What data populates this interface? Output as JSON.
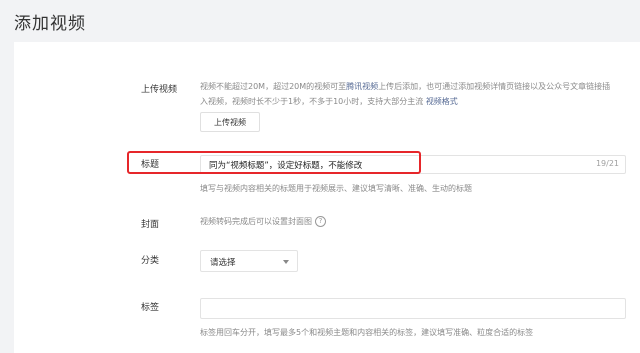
{
  "page": {
    "title": "添加视频"
  },
  "upload": {
    "label": "上传视频",
    "desc_part1": "视频不能超过20M，超过20M的视频可至",
    "desc_link1": "腾讯视频",
    "desc_part2": "上传后添加，也可通过添加视频详情页链接以及公众号文章链接插",
    "desc_line2_prefix": "入视频，视频时长不少于1秒，不多于10小时，支持大部分主流 ",
    "desc_link2": "视频格式",
    "button_label": "上传视频"
  },
  "title_field": {
    "label": "标题",
    "value": "同为“视频标题”，设定好标题，不能修改",
    "counter": "19/21",
    "hint": "填写与视频内容相关的标题用于视频展示、建议填写清晰、准确、生动的标题",
    "highlight_color": "#e6262a"
  },
  "cover": {
    "label": "封面",
    "desc": "视频转码完成后可以设置封面图",
    "help_icon": "question-circle-icon",
    "help_glyph": "?"
  },
  "category": {
    "label": "分类",
    "selected": "请选择",
    "caret_icon": "chevron-down-icon"
  },
  "tags": {
    "label": "标签",
    "hint": "标签用回车分开，填写最多5个和视频主题和内容相关的标签，建议填写准确、粒度合适的标签"
  },
  "colors": {
    "link": "#576b95",
    "background": "#f2f3f5",
    "card": "#ffffff"
  }
}
